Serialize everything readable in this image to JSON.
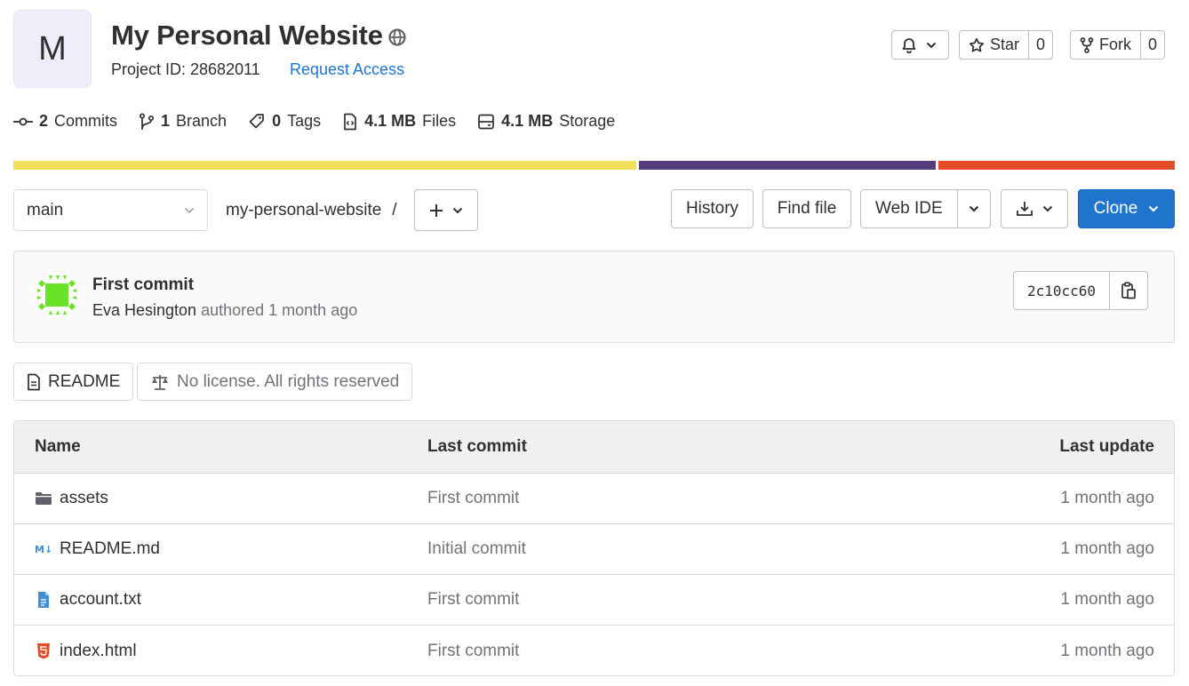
{
  "project": {
    "avatar_letter": "M",
    "title": "My Personal Website",
    "project_id_label": "Project ID: 28682011",
    "request_access": "Request Access"
  },
  "actions": {
    "star_label": "Star",
    "star_count": "0",
    "fork_label": "Fork",
    "fork_count": "0"
  },
  "stats": {
    "commits_count": "2",
    "commits_label": "Commits",
    "branch_count": "1",
    "branch_label": "Branch",
    "tags_count": "0",
    "tags_label": "Tags",
    "files_size": "4.1 MB",
    "files_label": "Files",
    "storage_size": "4.1 MB",
    "storage_label": "Storage"
  },
  "languages": [
    {
      "color": "#f1e05a",
      "fraction": 0.539
    },
    {
      "color": "#563d7c",
      "fraction": 0.257
    },
    {
      "color": "#e34c26",
      "fraction": 0.201
    }
  ],
  "toolbar": {
    "branch": "main",
    "path": "my-personal-website",
    "path_sep": "/",
    "history": "History",
    "find_file": "Find file",
    "web_ide": "Web IDE",
    "clone": "Clone"
  },
  "commit": {
    "title": "First commit",
    "author": "Eva Hesington",
    "meta": "authored 1 month ago",
    "sha": "2c10cc60",
    "avatar_color": "#6ae228"
  },
  "info": {
    "readme": "README",
    "license": "No license. All rights reserved"
  },
  "table": {
    "headers": {
      "name": "Name",
      "last_commit": "Last commit",
      "last_update": "Last update"
    },
    "rows": [
      {
        "name": "assets",
        "icon": "folder-icon",
        "commit": "First commit",
        "updated": "1 month ago"
      },
      {
        "name": "README.md",
        "icon": "markdown-icon",
        "commit": "Initial commit",
        "updated": "1 month ago"
      },
      {
        "name": "account.txt",
        "icon": "text-file-icon",
        "commit": "First commit",
        "updated": "1 month ago"
      },
      {
        "name": "index.html",
        "icon": "html-file-icon",
        "commit": "First commit",
        "updated": "1 month ago"
      }
    ]
  }
}
